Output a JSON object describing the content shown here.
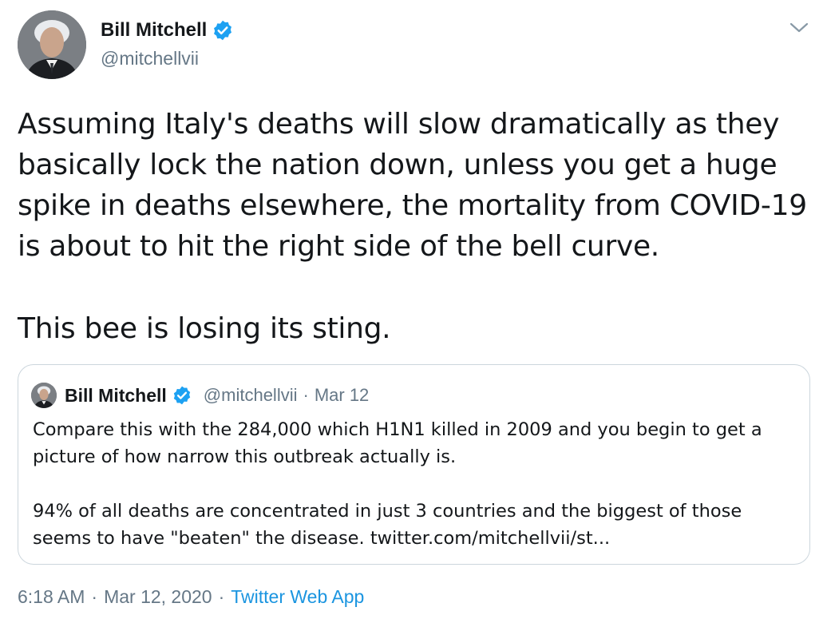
{
  "tweet": {
    "author_name": "Bill Mitchell",
    "author_handle": "@mitchellvii",
    "text_para1": "Assuming Italy's deaths will slow dramatically as they\nbasically lock the nation down, unless you get a huge\nspike in deaths elsewhere, the mortality from COVID-19\nis about to hit the right side of the bell curve.",
    "text_para2": "This bee is losing its sting.",
    "time": "6:18 AM",
    "date": "Mar 12, 2020",
    "source": "Twitter Web App"
  },
  "quoted_tweet": {
    "author_name": "Bill Mitchell",
    "author_handle": "@mitchellvii",
    "separator": "·",
    "date": "Mar 12",
    "text_para1": "Compare this with the 284,000 which H1N1 killed in 2009 and you begin to get a\npicture of how narrow this outbreak actually is.",
    "text_para2": "94% of all deaths are concentrated in just 3 countries and the biggest of those\nseems to have \"beaten\" the disease. twitter.com/mitchellvii/st..."
  },
  "footer": {
    "separator": "·"
  },
  "icons": {
    "verified": "verified-badge-icon",
    "more": "chevron-down-icon"
  },
  "colors": {
    "text_primary": "#14171a",
    "text_secondary": "#657786",
    "link": "#1b95e0",
    "verified": "#1da1f2",
    "border": "#ccd6dd"
  }
}
